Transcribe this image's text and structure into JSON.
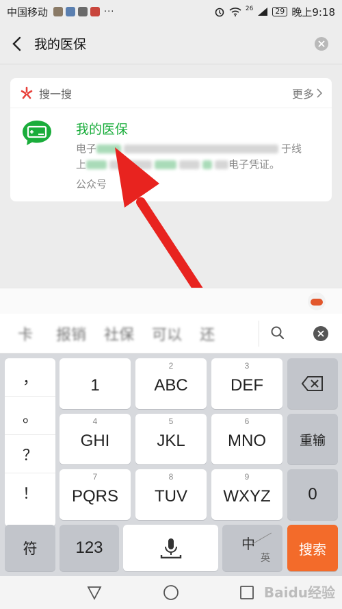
{
  "status_bar": {
    "carrier": "中国移动",
    "dots": "···",
    "signal_label": "26",
    "battery": "29",
    "time": "晚上9:18"
  },
  "navbar": {
    "query": "我的医保",
    "back_icon": "chevron-left-icon",
    "clear_icon": "clear-circle-icon"
  },
  "card": {
    "section_label": "搜一搜",
    "more_label": "更多",
    "result": {
      "title": "我的医保",
      "desc_line1_start": "电子",
      "desc_line1_end": "于线",
      "desc_line2_start": "上",
      "desc_line2_end": "电子凭证。",
      "source": "公众号"
    }
  },
  "candidates": [
    "卡",
    "报销",
    "社保",
    "可以",
    "还"
  ],
  "keyboard": {
    "punct": [
      "，",
      "。",
      "？",
      "！"
    ],
    "keys": [
      {
        "main": "1",
        "sub": ""
      },
      {
        "main": "ABC",
        "sub": "2"
      },
      {
        "main": "DEF",
        "sub": "3"
      },
      {
        "main": "GHI",
        "sub": "4"
      },
      {
        "main": "JKL",
        "sub": "5"
      },
      {
        "main": "MNO",
        "sub": "6"
      },
      {
        "main": "PQRS",
        "sub": "7"
      },
      {
        "main": "TUV",
        "sub": "8"
      },
      {
        "main": "WXYZ",
        "sub": "9"
      }
    ],
    "reenter": "重输",
    "zero": "0",
    "symbol": "符",
    "num123": "123",
    "lang_main": "中",
    "lang_sub": "英",
    "search": "搜索"
  },
  "watermark": "Baidu经验",
  "colors": {
    "accent_green": "#1aad3b",
    "search_orange": "#f36b2a",
    "arrow_red": "#e8231f"
  }
}
